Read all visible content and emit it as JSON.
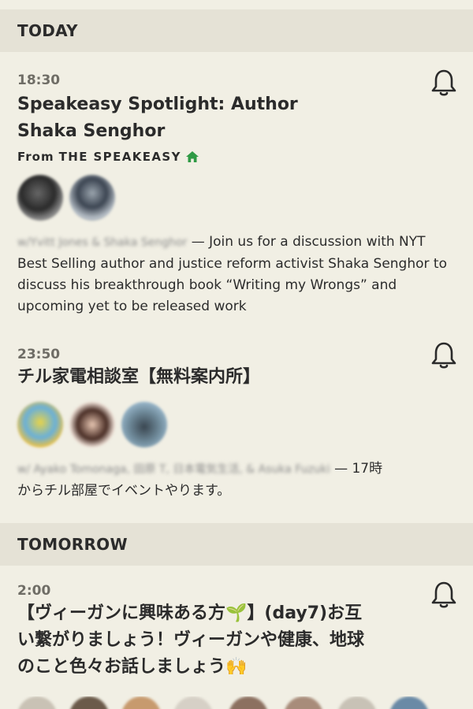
{
  "sections": {
    "today_label": "TODAY",
    "tomorrow_label": "TOMORROW"
  },
  "events": [
    {
      "time": "18:30",
      "title_line1": "Speakeasy Spotlight: Author",
      "title_line2": "Shaka Senghor",
      "from_label": "From",
      "club_name": "THE SPEAKEASY",
      "hosts": "w/Yvitt Jones & Shaka Senghor",
      "description": " — Join us for a discussion with NYT Best Selling author and justice reform activist Shaka Senghor to discuss his breakthrough book “Writing my Wrongs” and upcoming yet to be released work"
    },
    {
      "time": "23:50",
      "title_line1": "チル家電相談室【無料案内所】",
      "hosts": "w/ Ayako Tomonaga, 田原 T, 日本電気生活, & Asuka Fuzuki",
      "description_line1": " — 17時",
      "description_line2": "からチル部屋でイベントやります。"
    },
    {
      "time": "2:00",
      "title_line1": "【ヴィーガンに興味ある方🌱】(day7)お互",
      "title_line2": "い繋がりましょう！ヴィーガンや健康、地球",
      "title_line3": "のこと色々お話しましょう🙌"
    }
  ],
  "icons": {
    "bell": "bell-icon",
    "house": "house-icon"
  },
  "colors": {
    "background": "#f1efe4",
    "section_header_bg": "#e5e2d6",
    "house_green": "#2f9a45"
  }
}
